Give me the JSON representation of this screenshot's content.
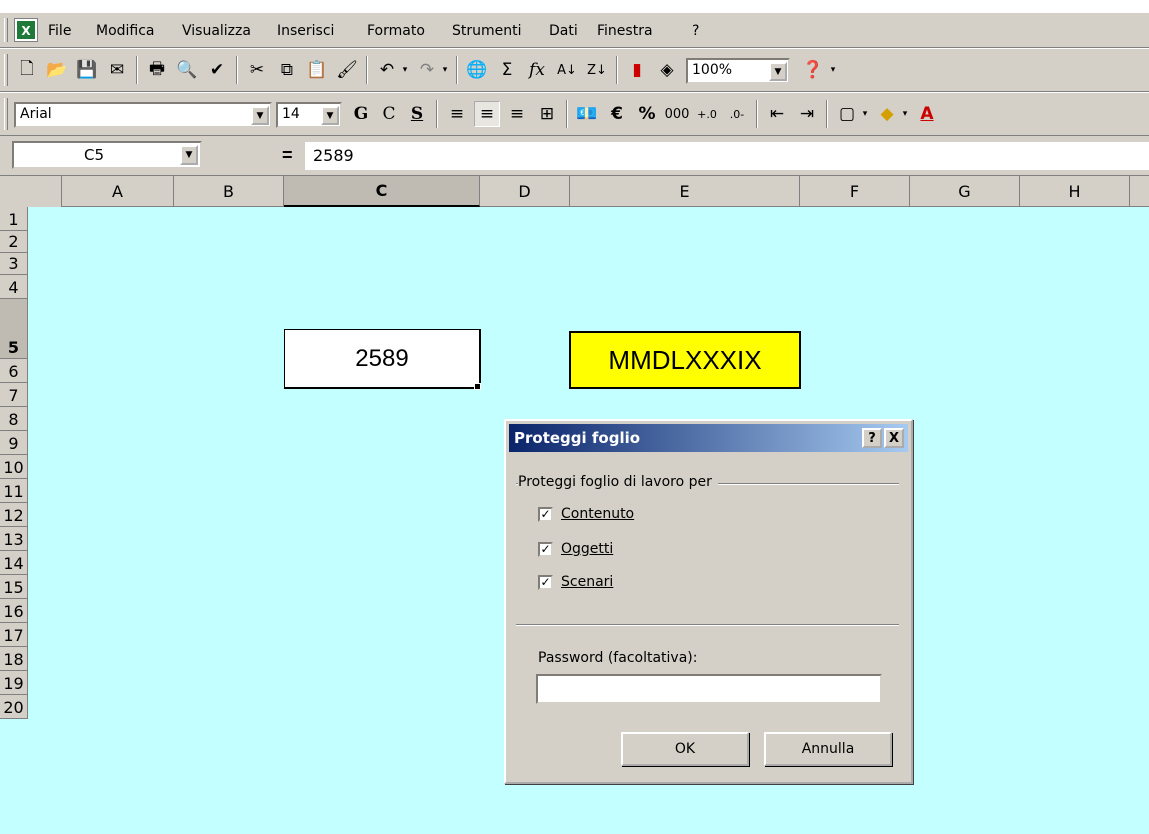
{
  "menu": {
    "items": [
      "File",
      "Modifica",
      "Visualizza",
      "Inserisci",
      "Formato",
      "Strumenti",
      "Dati",
      "Finestra",
      "?"
    ]
  },
  "toolbar": {
    "zoom": "100%"
  },
  "format_toolbar": {
    "font_name": "Arial",
    "font_size": "14",
    "bold": "G",
    "italic": "C",
    "underline": "S",
    "currency": "€",
    "percent": "%",
    "thousands": "000"
  },
  "formula_bar": {
    "name_box": "C5",
    "equals": "=",
    "content": "2589"
  },
  "columns": [
    "A",
    "B",
    "C",
    "D",
    "E",
    "F",
    "G",
    "H"
  ],
  "rows": [
    "1",
    "2",
    "3",
    "4",
    "5",
    "6",
    "7",
    "8",
    "9",
    "10",
    "11",
    "12",
    "13",
    "14",
    "15",
    "16",
    "17",
    "18",
    "19",
    "20"
  ],
  "cells": {
    "C5": "2589",
    "E5": "MMDLXXXIX"
  },
  "dialog": {
    "title": "Proteggi foglio",
    "help_btn": "?",
    "close_btn": "X",
    "group_label": "Proteggi foglio di lavoro per",
    "options": [
      {
        "label": "Contenuto",
        "checked": true
      },
      {
        "label": "Oggetti",
        "checked": true
      },
      {
        "label": "Scenari",
        "checked": true
      }
    ],
    "password_label": "Password (facoltativa):",
    "password_value": "",
    "ok_label": "OK",
    "cancel_label": "Annulla"
  }
}
